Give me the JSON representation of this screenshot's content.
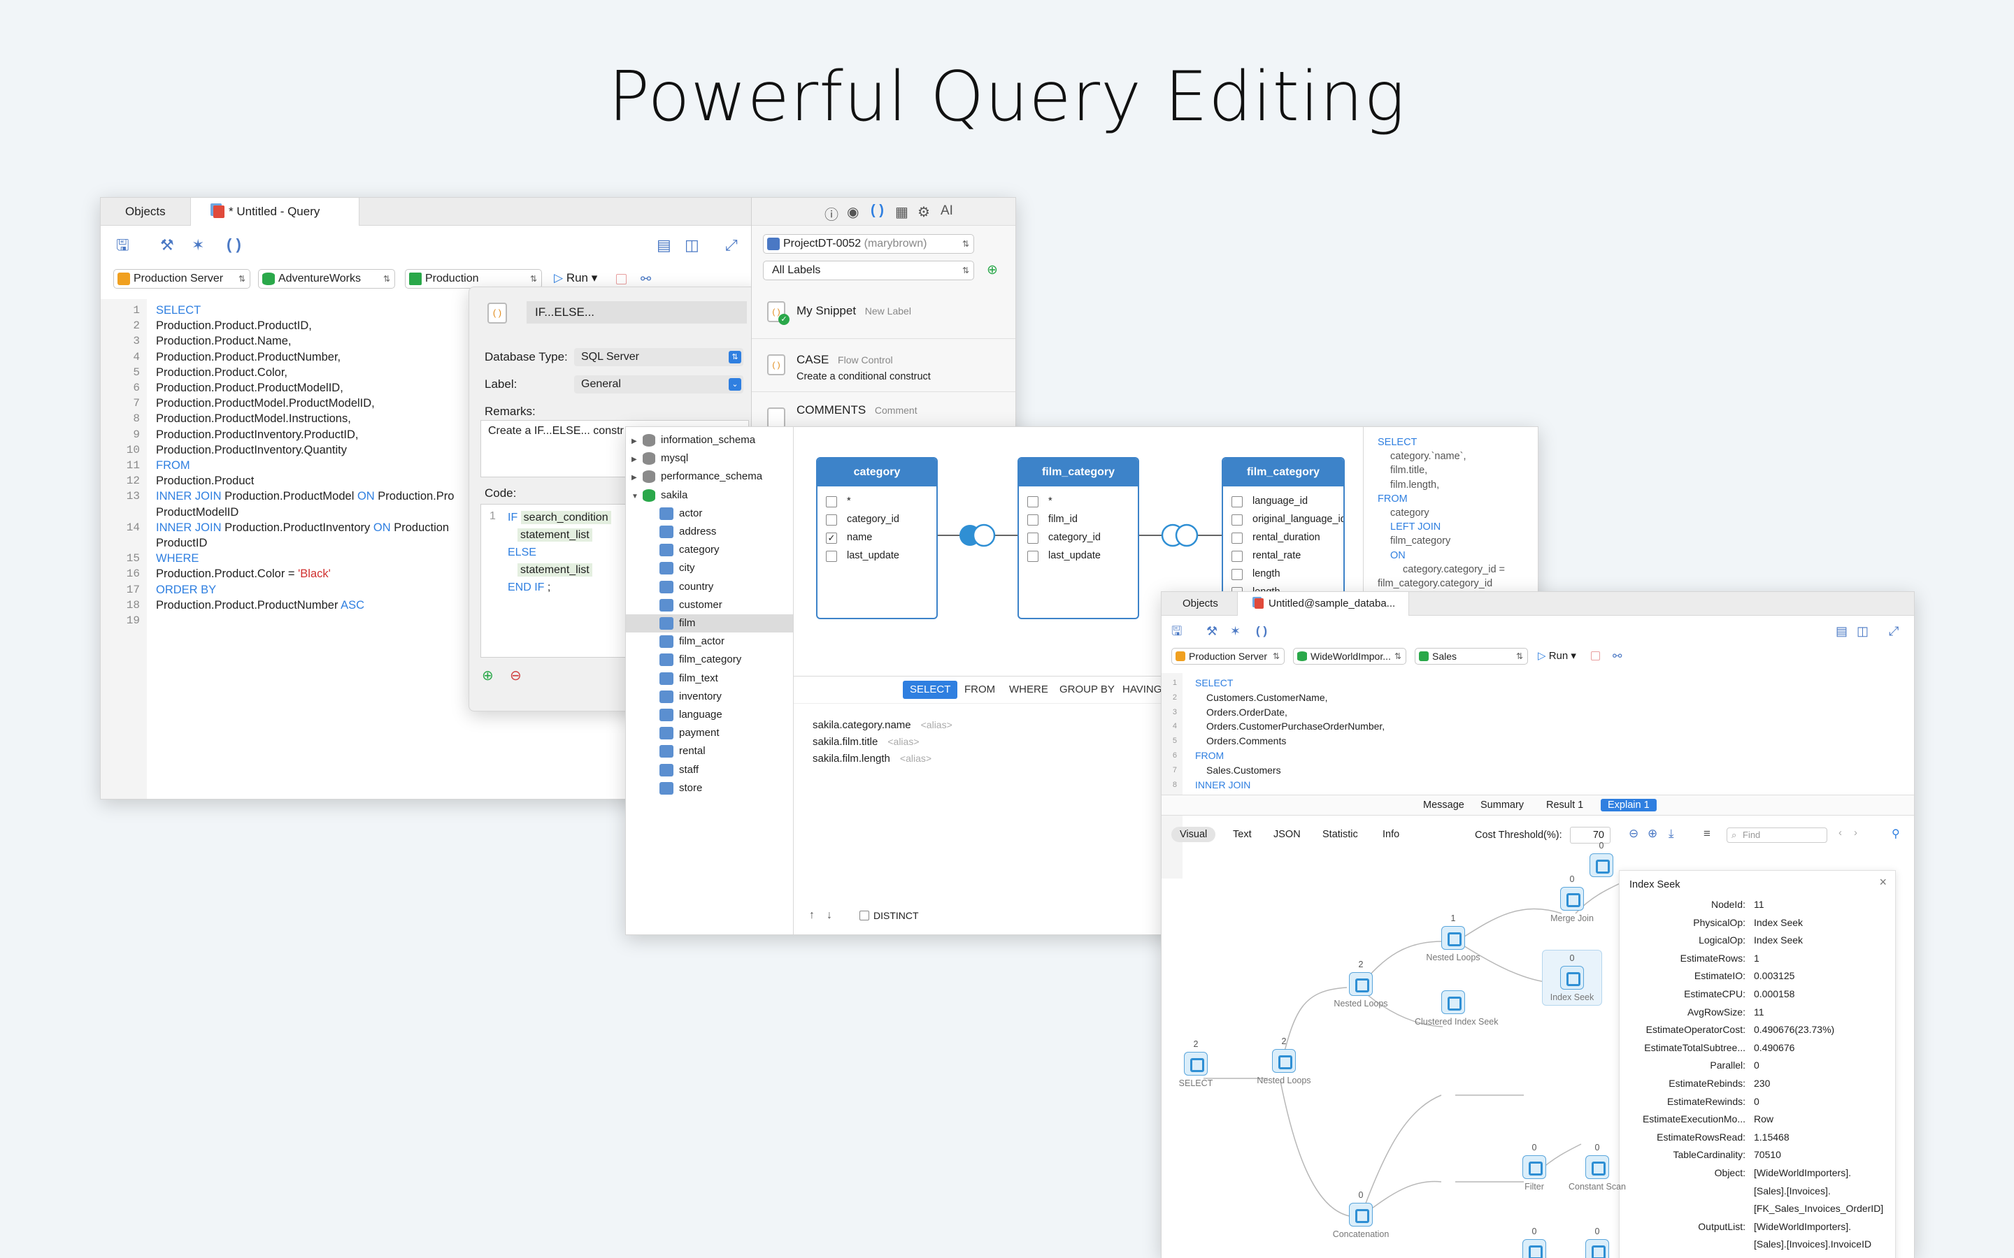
{
  "headline": "Powerful Query Editing",
  "editor": {
    "tabs": [
      "Objects",
      "* Untitled - Query"
    ],
    "connection": "Production Server",
    "database": "AdventureWorks",
    "schema": "Production",
    "run_label": "Run",
    "line_numbers": [
      "1",
      "2",
      "3",
      "4",
      "5",
      "6",
      "7",
      "8",
      "9",
      "10",
      "11",
      "12",
      "13",
      "",
      "14",
      "",
      "15",
      "16",
      "17",
      "18",
      "19"
    ],
    "code_lines": [
      {
        "kw": "SELECT",
        "t": ""
      },
      {
        "kw": "",
        "t": "Production.Product.ProductID,"
      },
      {
        "kw": "",
        "t": "Production.Product.Name,"
      },
      {
        "kw": "",
        "t": "Production.Product.ProductNumber,"
      },
      {
        "kw": "",
        "t": "Production.Product.Color,"
      },
      {
        "kw": "",
        "t": "Production.Product.ProductModelID,"
      },
      {
        "kw": "",
        "t": "Production.ProductModel.ProductModelID,"
      },
      {
        "kw": "",
        "t": "Production.ProductModel.Instructions,"
      },
      {
        "kw": "",
        "t": "Production.ProductInventory.ProductID,"
      },
      {
        "kw": "",
        "t": "Production.ProductInventory.Quantity"
      },
      {
        "kw": "FROM",
        "t": ""
      },
      {
        "kw": "",
        "t": "Production.Product"
      },
      {
        "kw": "INNER JOIN",
        "t": " Production.ProductModel ",
        "kw2": "ON",
        "t2": " Production.Pro"
      },
      {
        "kw": "",
        "t": "ProductModelID"
      },
      {
        "kw": "INNER JOIN",
        "t": " Production.ProductInventory ",
        "kw2": "ON",
        "t2": " Production"
      },
      {
        "kw": "",
        "t": "ProductID"
      },
      {
        "kw": "WHERE",
        "t": ""
      },
      {
        "kw": "",
        "t": "Production.Product.Color = ",
        "str": "'Black'"
      },
      {
        "kw": "ORDER BY",
        "t": ""
      },
      {
        "kw": "",
        "t": "Production.Product.ProductNumber ",
        "kw2": "ASC"
      },
      {
        "kw": "",
        "t": ""
      }
    ]
  },
  "snippet_popup": {
    "name": "IF...ELSE...",
    "db_type_label": "Database Type:",
    "db_type": "SQL Server",
    "label_label": "Label:",
    "label": "General",
    "remarks_label": "Remarks:",
    "remarks": "Create a IF...ELSE... constr",
    "code_label": "Code:",
    "code_line_no": "1",
    "code": {
      "if": "IF",
      "cond": "search_condition",
      "stmt1": "statement_list",
      "else": "ELSE",
      "stmt2": "statement_list",
      "endif": "END IF",
      "semi": ";"
    }
  },
  "snippets_panel": {
    "project": "ProjectDT-0052",
    "user": "(marybrown)",
    "labels_filter": "All Labels",
    "items": [
      {
        "name": "My Snippet",
        "tag": "New Label",
        "desc": ""
      },
      {
        "name": "CASE",
        "tag": "Flow Control",
        "desc": "Create a conditional construct"
      },
      {
        "name": "COMMENTS",
        "tag": "Comment",
        "desc": ""
      }
    ]
  },
  "builder": {
    "tree": [
      {
        "label": "information_schema",
        "type": "db",
        "level": 0
      },
      {
        "label": "mysql",
        "type": "db",
        "level": 0
      },
      {
        "label": "performance_schema",
        "type": "db",
        "level": 0
      },
      {
        "label": "sakila",
        "type": "dbopen",
        "level": 0
      },
      {
        "label": "actor",
        "type": "table",
        "level": 1
      },
      {
        "label": "address",
        "type": "table",
        "level": 1
      },
      {
        "label": "category",
        "type": "table",
        "level": 1
      },
      {
        "label": "city",
        "type": "table",
        "level": 1
      },
      {
        "label": "country",
        "type": "table",
        "level": 1
      },
      {
        "label": "customer",
        "type": "table",
        "level": 1
      },
      {
        "label": "film",
        "type": "table",
        "level": 1,
        "selected": true
      },
      {
        "label": "film_actor",
        "type": "table",
        "level": 1
      },
      {
        "label": "film_category",
        "type": "table",
        "level": 1
      },
      {
        "label": "film_text",
        "type": "table",
        "level": 1
      },
      {
        "label": "inventory",
        "type": "table",
        "level": 1
      },
      {
        "label": "language",
        "type": "table",
        "level": 1
      },
      {
        "label": "payment",
        "type": "table",
        "level": 1
      },
      {
        "label": "rental",
        "type": "table",
        "level": 1
      },
      {
        "label": "staff",
        "type": "table",
        "level": 1
      },
      {
        "label": "store",
        "type": "table",
        "level": 1
      }
    ],
    "entities": [
      {
        "title": "category",
        "fields": [
          {
            "n": "*",
            "c": false
          },
          {
            "n": "category_id",
            "c": false
          },
          {
            "n": "name",
            "c": true
          },
          {
            "n": "last_update",
            "c": false
          }
        ]
      },
      {
        "title": "film_category",
        "fields": [
          {
            "n": "*",
            "c": false
          },
          {
            "n": "film_id",
            "c": false
          },
          {
            "n": "category_id",
            "c": false
          },
          {
            "n": "last_update",
            "c": false
          }
        ]
      },
      {
        "title": "film_category",
        "fields": [
          {
            "n": "language_id",
            "c": false
          },
          {
            "n": "original_language_id",
            "c": false
          },
          {
            "n": "rental_duration",
            "c": false
          },
          {
            "n": "rental_rate",
            "c": false
          },
          {
            "n": "length",
            "c": false
          },
          {
            "n": "length",
            "c": false
          }
        ]
      }
    ],
    "clauses": [
      "SELECT",
      "FROM",
      "WHERE",
      "GROUP BY",
      "HAVING"
    ],
    "select_fields": [
      {
        "field": "sakila.category.name",
        "alias": "<alias>"
      },
      {
        "field": "sakila.film.title",
        "alias": "<alias>"
      },
      {
        "field": "sakila.film.length",
        "alias": "<alias>"
      }
    ],
    "distinct_label": "DISTINCT",
    "sql_preview": [
      {
        "k": "SELECT",
        "t": "",
        "i": 0
      },
      {
        "k": "",
        "t": "category.`name`,",
        "i": 1
      },
      {
        "k": "",
        "t": "film.title,",
        "i": 1
      },
      {
        "k": "",
        "t": "film.length,",
        "i": 1
      },
      {
        "k": "FROM",
        "t": "",
        "i": 0
      },
      {
        "k": "",
        "t": "category",
        "i": 1
      },
      {
        "k": "LEFT JOIN",
        "t": "",
        "i": 1
      },
      {
        "k": "",
        "t": "film_category",
        "i": 1
      },
      {
        "k": "ON",
        "t": "",
        "i": 1
      },
      {
        "k": "",
        "t": "category.category_id =",
        "i": 2
      },
      {
        "k": "",
        "t": "film_category.category_id",
        "i": 0
      }
    ]
  },
  "explain": {
    "tabs": [
      "Objects",
      "Untitled@sample_databa..."
    ],
    "connection": "Production Server",
    "database": "WideWorldImpor...",
    "schema": "Sales",
    "run_label": "Run",
    "code_lines": [
      {
        "n": "1",
        "kw": "SELECT",
        "t": ""
      },
      {
        "n": "2",
        "kw": "",
        "t": "Customers.CustomerName,"
      },
      {
        "n": "3",
        "kw": "",
        "t": "Orders.OrderDate,"
      },
      {
        "n": "4",
        "kw": "",
        "t": "Orders.CustomerPurchaseOrderNumber,"
      },
      {
        "n": "5",
        "kw": "",
        "t": "Orders.Comments"
      },
      {
        "n": "6",
        "kw": "FROM",
        "t": ""
      },
      {
        "n": "7",
        "kw": "",
        "t": "Sales.Customers"
      },
      {
        "n": "8",
        "kw": "INNER JOIN",
        "t": ""
      }
    ],
    "result_tabs": [
      "Message",
      "Summary",
      "Result 1",
      "Explain 1"
    ],
    "view_tabs": [
      "Visual",
      "Text",
      "JSON",
      "Statistic",
      "Info"
    ],
    "cost_label": "Cost Threshold(%):",
    "cost_value": "70",
    "find_placeholder": "Find",
    "nodes": [
      {
        "label": "SELECT",
        "count": "2"
      },
      {
        "label": "Nested Loops",
        "count": "2"
      },
      {
        "label": "Nested Loops",
        "count": "2"
      },
      {
        "label": "Nested Loops",
        "count": "1"
      },
      {
        "label": "Merge Join",
        "count": "0"
      },
      {
        "label": "Index Seek",
        "count": "0"
      },
      {
        "label": "Clustered Index Seek",
        "count": ""
      },
      {
        "label": "Filter",
        "count": "0"
      },
      {
        "label": "Constant Scan",
        "count": "0"
      },
      {
        "label": "Filter",
        "count": "0"
      },
      {
        "label": "Nested Loops",
        "count": "0"
      },
      {
        "label": "Concatenation",
        "count": "0"
      },
      {
        "label": "",
        "count": "0"
      }
    ],
    "detail": {
      "title": "Index Seek",
      "rows": [
        {
          "k": "NodeId:",
          "v": "11"
        },
        {
          "k": "PhysicalOp:",
          "v": "Index Seek"
        },
        {
          "k": "LogicalOp:",
          "v": "Index Seek"
        },
        {
          "k": "EstimateRows:",
          "v": "1"
        },
        {
          "k": "EstimateIO:",
          "v": "0.003125"
        },
        {
          "k": "EstimateCPU:",
          "v": "0.000158"
        },
        {
          "k": "AvgRowSize:",
          "v": "11"
        },
        {
          "k": "EstimateOperatorCost:",
          "v": "0.490676(23.73%)"
        },
        {
          "k": "EstimateTotalSubtree...",
          "v": "0.490676"
        },
        {
          "k": "Parallel:",
          "v": "0"
        },
        {
          "k": "EstimateRebinds:",
          "v": "230"
        },
        {
          "k": "EstimateRewinds:",
          "v": "0"
        },
        {
          "k": "EstimateExecutionMo...",
          "v": "Row"
        },
        {
          "k": "EstimateRowsRead:",
          "v": "1.15468"
        },
        {
          "k": "TableCardinality:",
          "v": "70510"
        },
        {
          "k": "Object:",
          "v": "[WideWorldImporters]."
        },
        {
          "k": "",
          "v": "[Sales].[Invoices]."
        },
        {
          "k": "",
          "v": "[FK_Sales_Invoices_OrderID]"
        },
        {
          "k": "OutputList:",
          "v": "[WideWorldImporters]."
        },
        {
          "k": "",
          "v": "[Sales].[Invoices].InvoiceID"
        }
      ]
    }
  }
}
